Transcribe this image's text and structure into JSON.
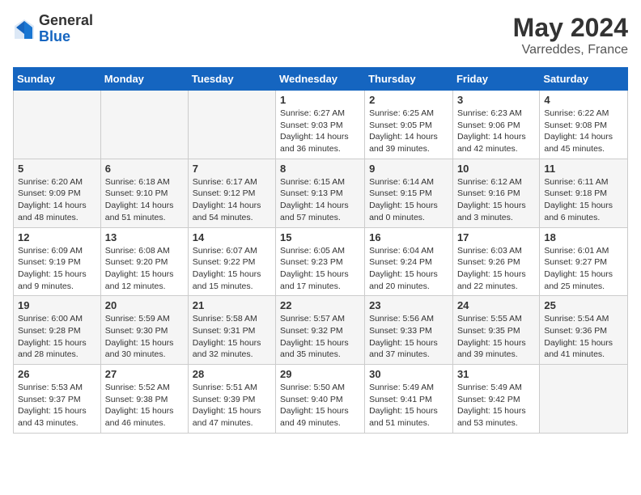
{
  "header": {
    "logo_general": "General",
    "logo_blue": "Blue",
    "month_year": "May 2024",
    "location": "Varreddes, France"
  },
  "days_of_week": [
    "Sunday",
    "Monday",
    "Tuesday",
    "Wednesday",
    "Thursday",
    "Friday",
    "Saturday"
  ],
  "weeks": [
    [
      {
        "day": "",
        "info": ""
      },
      {
        "day": "",
        "info": ""
      },
      {
        "day": "",
        "info": ""
      },
      {
        "day": "1",
        "info": "Sunrise: 6:27 AM\nSunset: 9:03 PM\nDaylight: 14 hours\nand 36 minutes."
      },
      {
        "day": "2",
        "info": "Sunrise: 6:25 AM\nSunset: 9:05 PM\nDaylight: 14 hours\nand 39 minutes."
      },
      {
        "day": "3",
        "info": "Sunrise: 6:23 AM\nSunset: 9:06 PM\nDaylight: 14 hours\nand 42 minutes."
      },
      {
        "day": "4",
        "info": "Sunrise: 6:22 AM\nSunset: 9:08 PM\nDaylight: 14 hours\nand 45 minutes."
      }
    ],
    [
      {
        "day": "5",
        "info": "Sunrise: 6:20 AM\nSunset: 9:09 PM\nDaylight: 14 hours\nand 48 minutes."
      },
      {
        "day": "6",
        "info": "Sunrise: 6:18 AM\nSunset: 9:10 PM\nDaylight: 14 hours\nand 51 minutes."
      },
      {
        "day": "7",
        "info": "Sunrise: 6:17 AM\nSunset: 9:12 PM\nDaylight: 14 hours\nand 54 minutes."
      },
      {
        "day": "8",
        "info": "Sunrise: 6:15 AM\nSunset: 9:13 PM\nDaylight: 14 hours\nand 57 minutes."
      },
      {
        "day": "9",
        "info": "Sunrise: 6:14 AM\nSunset: 9:15 PM\nDaylight: 15 hours\nand 0 minutes."
      },
      {
        "day": "10",
        "info": "Sunrise: 6:12 AM\nSunset: 9:16 PM\nDaylight: 15 hours\nand 3 minutes."
      },
      {
        "day": "11",
        "info": "Sunrise: 6:11 AM\nSunset: 9:18 PM\nDaylight: 15 hours\nand 6 minutes."
      }
    ],
    [
      {
        "day": "12",
        "info": "Sunrise: 6:09 AM\nSunset: 9:19 PM\nDaylight: 15 hours\nand 9 minutes."
      },
      {
        "day": "13",
        "info": "Sunrise: 6:08 AM\nSunset: 9:20 PM\nDaylight: 15 hours\nand 12 minutes."
      },
      {
        "day": "14",
        "info": "Sunrise: 6:07 AM\nSunset: 9:22 PM\nDaylight: 15 hours\nand 15 minutes."
      },
      {
        "day": "15",
        "info": "Sunrise: 6:05 AM\nSunset: 9:23 PM\nDaylight: 15 hours\nand 17 minutes."
      },
      {
        "day": "16",
        "info": "Sunrise: 6:04 AM\nSunset: 9:24 PM\nDaylight: 15 hours\nand 20 minutes."
      },
      {
        "day": "17",
        "info": "Sunrise: 6:03 AM\nSunset: 9:26 PM\nDaylight: 15 hours\nand 22 minutes."
      },
      {
        "day": "18",
        "info": "Sunrise: 6:01 AM\nSunset: 9:27 PM\nDaylight: 15 hours\nand 25 minutes."
      }
    ],
    [
      {
        "day": "19",
        "info": "Sunrise: 6:00 AM\nSunset: 9:28 PM\nDaylight: 15 hours\nand 28 minutes."
      },
      {
        "day": "20",
        "info": "Sunrise: 5:59 AM\nSunset: 9:30 PM\nDaylight: 15 hours\nand 30 minutes."
      },
      {
        "day": "21",
        "info": "Sunrise: 5:58 AM\nSunset: 9:31 PM\nDaylight: 15 hours\nand 32 minutes."
      },
      {
        "day": "22",
        "info": "Sunrise: 5:57 AM\nSunset: 9:32 PM\nDaylight: 15 hours\nand 35 minutes."
      },
      {
        "day": "23",
        "info": "Sunrise: 5:56 AM\nSunset: 9:33 PM\nDaylight: 15 hours\nand 37 minutes."
      },
      {
        "day": "24",
        "info": "Sunrise: 5:55 AM\nSunset: 9:35 PM\nDaylight: 15 hours\nand 39 minutes."
      },
      {
        "day": "25",
        "info": "Sunrise: 5:54 AM\nSunset: 9:36 PM\nDaylight: 15 hours\nand 41 minutes."
      }
    ],
    [
      {
        "day": "26",
        "info": "Sunrise: 5:53 AM\nSunset: 9:37 PM\nDaylight: 15 hours\nand 43 minutes."
      },
      {
        "day": "27",
        "info": "Sunrise: 5:52 AM\nSunset: 9:38 PM\nDaylight: 15 hours\nand 46 minutes."
      },
      {
        "day": "28",
        "info": "Sunrise: 5:51 AM\nSunset: 9:39 PM\nDaylight: 15 hours\nand 47 minutes."
      },
      {
        "day": "29",
        "info": "Sunrise: 5:50 AM\nSunset: 9:40 PM\nDaylight: 15 hours\nand 49 minutes."
      },
      {
        "day": "30",
        "info": "Sunrise: 5:49 AM\nSunset: 9:41 PM\nDaylight: 15 hours\nand 51 minutes."
      },
      {
        "day": "31",
        "info": "Sunrise: 5:49 AM\nSunset: 9:42 PM\nDaylight: 15 hours\nand 53 minutes."
      },
      {
        "day": "",
        "info": ""
      }
    ]
  ]
}
